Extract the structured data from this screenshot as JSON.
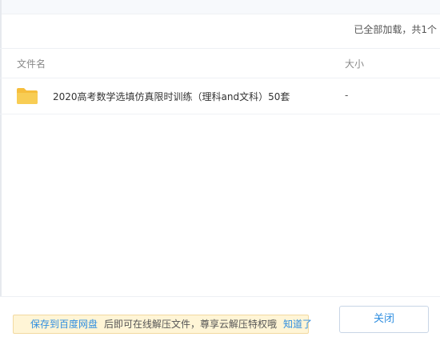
{
  "status": {
    "loaded_text": "已全部加载，共1个"
  },
  "table": {
    "headers": {
      "name": "文件名",
      "size": "大小"
    },
    "rows": [
      {
        "icon": "folder-icon",
        "name": "2020高考数学选填仿真限时训练（理科and文科）50套",
        "size": "-"
      }
    ]
  },
  "footer": {
    "save_link": "保存到百度网盘",
    "notice_text": "后即可在线解压文件，尊享云解压特权哦",
    "got_it_link": "知道了",
    "close_button": "关闭"
  },
  "colors": {
    "accent": "#2f8ee0",
    "folder": "#f8c94a",
    "notice_bg": "#fff5d6"
  }
}
